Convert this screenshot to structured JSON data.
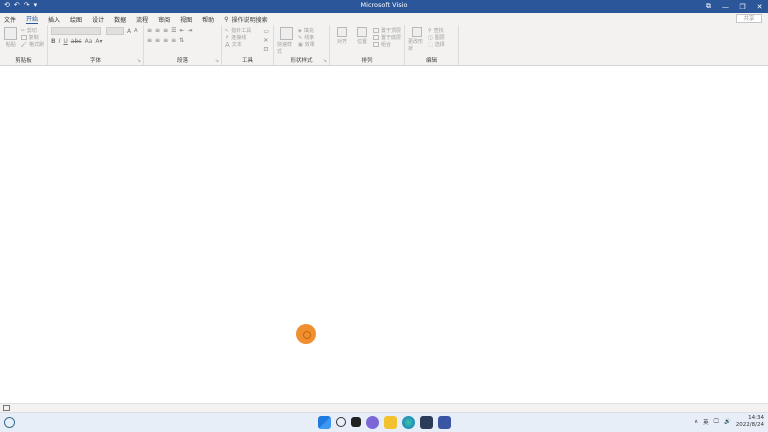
{
  "window": {
    "title": "Microsoft Visio",
    "controls": [
      "⧉",
      "—",
      "❐",
      "✕"
    ]
  },
  "qat": [
    "⟲",
    "↶",
    "↷",
    "▾"
  ],
  "tabs": [
    "文件",
    "开始",
    "插入",
    "绘图",
    "设计",
    "数据",
    "流程",
    "审阅",
    "视图",
    "帮助"
  ],
  "tellme": {
    "icon": "lightbulb-icon",
    "text": "操作说明搜索"
  },
  "share_label": "共享",
  "ribbon": {
    "clipboard": {
      "label": "剪贴板",
      "paste": "粘贴",
      "cut": "剪切",
      "copy": "复制",
      "format_painter": "格式刷"
    },
    "font": {
      "label": "字体",
      "bold": "B",
      "italic": "I",
      "underline": "U",
      "strike": "abc",
      "case": "Aa",
      "grow": "A",
      "shrink": "A"
    },
    "paragraph": {
      "label": "段落"
    },
    "tools": {
      "label": "工具",
      "pointer": "指针工具",
      "connector": "连接线",
      "text": "文本"
    },
    "shape_styles": {
      "label": "形状样式",
      "quick_styles": "快速样式",
      "fill": "填充",
      "line": "线条",
      "effects": "效果"
    },
    "arrange": {
      "label": "排列",
      "align": "对齐",
      "position": "位置",
      "bring_front": "置于顶层",
      "send_back": "置于底层",
      "group": "组合"
    },
    "editing": {
      "label": "编辑",
      "change_shape": "更改形状",
      "find": "查找",
      "layers": "图层",
      "select": "选择"
    }
  },
  "taskbar": {
    "icons": [
      "windows-icon",
      "search-icon",
      "taskview-icon",
      "chat-icon",
      "explorer-icon",
      "edge-icon",
      "store-icon",
      "visio-icon"
    ],
    "tray": {
      "chevron": "∧",
      "ime": "英",
      "time": "14:34",
      "date": "2022/8/24"
    }
  },
  "colors": {
    "accent": "#2b579a",
    "cursor": "#f08a24"
  }
}
